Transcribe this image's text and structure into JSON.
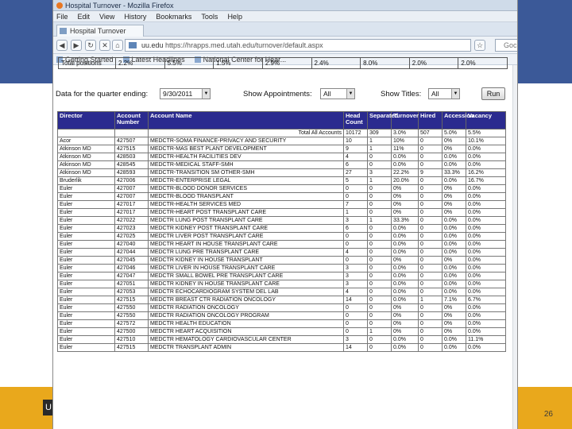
{
  "browser": {
    "title": "Hospital Turnover - Mozilla Firefox",
    "menu": [
      "File",
      "Edit",
      "View",
      "History",
      "Bookmarks",
      "Tools",
      "Help"
    ],
    "tab_label": "Hospital Turnover",
    "url_prefix": "uu.edu",
    "url_rest": "https://hrapps.med.utah.edu/turnover/default.aspx",
    "search_placeholder": "Goc",
    "bookmarks": [
      "Getting Started",
      "Latest Headlines",
      "National Center for Hear..."
    ]
  },
  "top_row": {
    "label": "Total positions",
    "values": [
      "2.2%",
      "5.5%",
      "1.5%",
      "2.9%",
      "2.4%",
      "8.0%",
      "2.0%",
      "2.0%"
    ]
  },
  "filters": {
    "quarter_label": "Data for the quarter ending:",
    "quarter_value": "9/30/2011",
    "appointments_label": "Show Appointments:",
    "appointments_value": "All",
    "titles_label": "Show Titles:",
    "titles_value": "All",
    "run_label": "Run"
  },
  "table": {
    "headers": [
      "Director",
      "Account Number",
      "Account Name",
      "Head Count",
      "Separated",
      "Turnover",
      "Hired",
      "Accession",
      "Vacancy"
    ],
    "total": {
      "label": "Total All Accounts",
      "head": "10172",
      "sep": "309",
      "turn": "3.0%",
      "hired": "507",
      "acc": "5.0%",
      "vac": "5.5%"
    },
    "rows": [
      [
        "Acor",
        "427507",
        "MEDCTR-SOMA FINANCE-PRIVACY AND SECURITY",
        "10",
        "1",
        "10%",
        "0",
        "0%",
        "10.1%"
      ],
      [
        "Atkinson MD",
        "427515",
        "MEDCTR-MAS BEST PLANT DEVELOPMENT",
        "9",
        "1",
        "11%",
        "0",
        "0%",
        "0.0%"
      ],
      [
        "Atkinson MD",
        "428503",
        "MEDCTR-HEALTH FACILITIES DEV",
        "4",
        "0",
        "0.0%",
        "0",
        "0.0%",
        "0.0%"
      ],
      [
        "Atkinson MD",
        "428545",
        "MEDCTR-MEDICAL STAFF-SMH",
        "6",
        "0",
        "0.0%",
        "0",
        "0.0%",
        "0.0%"
      ],
      [
        "Atkinson MD",
        "428593",
        "MEDCTR-TRANSITION SM OTHER-SMH",
        "27",
        "3",
        "22.2%",
        "9",
        "33.3%",
        "16.2%"
      ],
      [
        "Bruderlik",
        "427006",
        "MEDCTR-ENTERPRISE LEGAL",
        "5",
        "1",
        "20.0%",
        "0",
        "0.0%",
        "16.7%"
      ],
      [
        "Euler",
        "427007",
        "MEDCTR-BLOOD DONOR SERVICES",
        "0",
        "0",
        "0%",
        "0",
        "0%",
        "0.0%"
      ],
      [
        "Euler",
        "427007",
        "MEDCTR-BLOOD TRANSPLANT",
        "0",
        "0",
        "0%",
        "0",
        "0%",
        "0.0%"
      ],
      [
        "Euler",
        "427017",
        "MEDCTR-HEALTH SERVICES MED",
        "7",
        "0",
        "0%",
        "0",
        "0%",
        "0.0%"
      ],
      [
        "Euler",
        "427017",
        "MEDCTR-HEART POST TRANSPLANT CARE",
        "1",
        "0",
        "0%",
        "0",
        "0%",
        "0.0%"
      ],
      [
        "Euler",
        "427022",
        "MEDCTR LUNG POST TRANSPLANT CARE",
        "3",
        "1",
        "33.3%",
        "0",
        "0.0%",
        "0.0%"
      ],
      [
        "Euler",
        "427023",
        "MEDCTR KIDNEY POST TRANSPLANT CARE",
        "6",
        "0",
        "0.0%",
        "0",
        "0.0%",
        "0.0%"
      ],
      [
        "Euler",
        "427025",
        "MEDCTR LIVER POST TRANSPLANT CARE",
        "0",
        "0",
        "0.0%",
        "0",
        "0.0%",
        "0.0%"
      ],
      [
        "Euler",
        "427040",
        "MEDCTR HEART IN HOUSE TRANSPLANT CARE",
        "0",
        "0",
        "0.0%",
        "0",
        "0.0%",
        "0.0%"
      ],
      [
        "Euler",
        "427044",
        "MEDCTR LUNG PRE TRANSPLANT CARE",
        "4",
        "0",
        "0.0%",
        "0",
        "0.0%",
        "0.0%"
      ],
      [
        "Euler",
        "427045",
        "MEDCTR KIDNEY IN HOUSE TRANSPLANT",
        "0",
        "0",
        "0%",
        "0",
        "0%",
        "0.0%"
      ],
      [
        "Euler",
        "427046",
        "MEDCTR LIVER IN HOUSE TRANSPLANT CARE",
        "3",
        "0",
        "0.0%",
        "0",
        "0.0%",
        "0.0%"
      ],
      [
        "Euler",
        "427047",
        "MEDCTR SMALL BOWEL PRE TRANSPLANT CARE",
        "3",
        "0",
        "0.0%",
        "0",
        "0.0%",
        "0.0%"
      ],
      [
        "Euler",
        "427051",
        "MEDCTR KIDNEY IN HOUSE TRANSPLANT CARE",
        "3",
        "0",
        "0.0%",
        "0",
        "0.0%",
        "0.0%"
      ],
      [
        "Euler",
        "427053",
        "MEDCTR ECHOCARDIOGRAM SYSTEM DEL LAB",
        "4",
        "0",
        "0.0%",
        "0",
        "0.0%",
        "0.0%"
      ],
      [
        "Euler",
        "427515",
        "MEDCTR BREAST CTR RADIATION ONCOLOGY",
        "14",
        "0",
        "0.0%",
        "1",
        "7.1%",
        "6.7%"
      ],
      [
        "Euler",
        "427550",
        "MEDCTR RADIATION ONCOLOGY",
        "0",
        "0",
        "0%",
        "0",
        "0%",
        "0.0%"
      ],
      [
        "Euler",
        "427550",
        "MEDCTR RADIATION ONCOLOGY PROGRAM",
        "0",
        "0",
        "0%",
        "0",
        "0%",
        "0.0%"
      ],
      [
        "Euler",
        "427572",
        "MEDCTR HEALTH EDUCATION",
        "0",
        "0",
        "0%",
        "0",
        "0%",
        "0.0%"
      ],
      [
        "Euler",
        "427500",
        "MEDCTR HEART ACQUISITION",
        "0",
        "1",
        "0%",
        "0",
        "0%",
        "0.0%"
      ],
      [
        "Euler",
        "427510",
        "MEDCTR HEMATOLOGY CARDIOVASCULAR CENTER",
        "3",
        "0",
        "0.0%",
        "0",
        "0.0%",
        "11.1%"
      ],
      [
        "Euler",
        "427515",
        "MEDCTR TRANSPLANT ADMIN",
        "14",
        "0",
        "0.0%",
        "0",
        "0.0%",
        "0.0%"
      ]
    ]
  },
  "slide": {
    "page_number": "26",
    "logo": "U"
  }
}
